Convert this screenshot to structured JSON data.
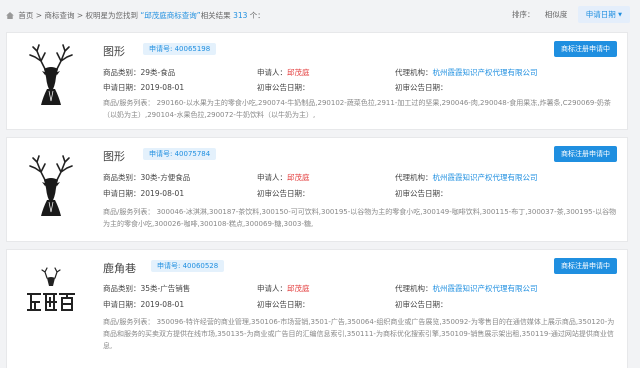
{
  "breadcrumb": {
    "home": "首页",
    "sep1": " > ",
    "search": "商标查询",
    "sep2": " > ",
    "prefix": "权明星为您找到 ",
    "keyword": "“邱茂庭商标查询”",
    "mid": "相关结果 ",
    "count": "313",
    "suffix": " 个："
  },
  "sort": {
    "label": "排序：",
    "relevance": "相似度",
    "date": "申请日期",
    "date_arrow": "▼"
  },
  "results": [
    {
      "name": "图形",
      "regno": "申请号: 40065198",
      "action": "商标注册申请中",
      "category_label": "商品类别：",
      "category": "29类-食品",
      "applicant_label": "申请人：",
      "applicant": "邱茂庭",
      "agency_label": "代理机构：",
      "agency": "杭州霞霞知识产权代理有限公司",
      "apply_date_label": "申请日期：",
      "apply_date": "2019-08-01",
      "first_pub_label": "初审公告日期：",
      "first_pub": "",
      "reg_pub_label": "初审公告日期：",
      "reg_pub": "",
      "services": "商品/服务列表：  290160-以水果为主的零食小吃,290074-牛奶制品,290102-蔬菜色拉,2911-加工过的坚果,290046-肉,290048-食用果冻,炸薯条,C290069-奶茶（以奶为主）,290104-水果色拉,290072-牛奶饮料（以牛奶为主）,"
    },
    {
      "name": "图形",
      "regno": "申请号: 40075784",
      "action": "商标注册申请中",
      "category_label": "商品类别：",
      "category": "30类-方便食品",
      "applicant_label": "申请人：",
      "applicant": "邱茂庭",
      "agency_label": "代理机构：",
      "agency": "杭州霞霞知识产权代理有限公司",
      "apply_date_label": "申请日期：",
      "apply_date": "2019-08-01",
      "first_pub_label": "初审公告日期：",
      "first_pub": "",
      "reg_pub_label": "初审公告日期：",
      "reg_pub": "",
      "services": "商品/服务列表：  300046-冰淇淋,300187-茶饮料,300150-可可饮料,300195-以谷物为主的零食小吃,300149-咖啡饮料,300115-布丁,300037-茶,300195-以谷物为主的零食小吃,300026-咖啡,300108-糕点,300069-糖,3003-糖,"
    },
    {
      "name": "鹿角巷",
      "regno": "申请号: 40060528",
      "action": "商标注册申请中",
      "category_label": "商品类别：",
      "category": "35类-广告销售",
      "applicant_label": "申请人：",
      "applicant": "邱茂庭",
      "agency_label": "代理机构：",
      "agency": "杭州霞霞知识产权代理有限公司",
      "apply_date_label": "申请日期：",
      "apply_date": "2019-08-01",
      "first_pub_label": "初审公告日期：",
      "first_pub": "",
      "reg_pub_label": "初审公告日期：",
      "reg_pub": "",
      "services": "商品/服务列表：  350096-特许经营的商业管理,350106-市场营销,3501-广告,350064-组织商业或广告展览,350092-为零售目的在通信媒体上展示商品,350120-为商品和服务的买卖双方提供在线市场,350135-为商业或广告目的汇编信息索引,350111-为商标优化搜索引擎,350109-销售展示架出租,350119-通过网站提供商业信息,"
    }
  ]
}
